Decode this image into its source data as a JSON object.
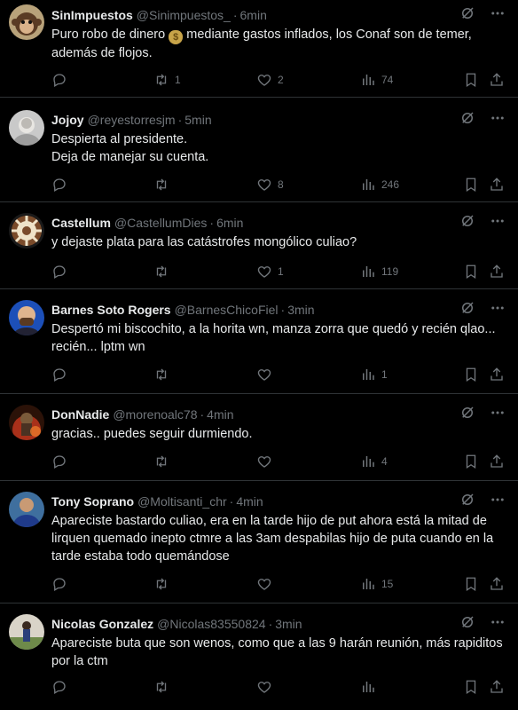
{
  "tweets": [
    {
      "name": "SinImpuestos",
      "handle": "@Sinimpuestos_",
      "time": "6min",
      "lines": [
        "Puro robo de dinero",
        "mediante gastos inflados, los Conaf son de temer,",
        "además de flojos."
      ],
      "emoji": "money-bag-emoji",
      "replies": "",
      "retweets": "1",
      "likes": "2",
      "views": "74",
      "avatar": "monkey-avatar"
    },
    {
      "name": "Jojoy",
      "handle": "@reyestorresjm",
      "time": "5min",
      "lines": [
        "Despierta al presidente.",
        "Deja de manejar su cuenta."
      ],
      "replies": "",
      "retweets": "",
      "likes": "8",
      "views": "246",
      "avatar": "person-avatar"
    },
    {
      "name": "Castellum",
      "handle": "@CastellumDies",
      "time": "6min",
      "lines": [
        "y dejaste plata para las catástrofes mongólico culiao?"
      ],
      "replies": "",
      "retweets": "",
      "likes": "1",
      "views": "119",
      "avatar": "wheel-avatar"
    },
    {
      "name": "Barnes Soto Rogers",
      "handle": "@BarnesChicoFiel",
      "time": "3min",
      "lines": [
        "Despertó mi biscochito, a la horita wn, manza zorra que quedó y recién qlao...",
        "recién... lptm wn"
      ],
      "replies": "",
      "retweets": "",
      "likes": "",
      "views": "1",
      "avatar": "bald-man-avatar"
    },
    {
      "name": "DonNadie",
      "handle": "@morenoalc78",
      "time": "4min",
      "lines": [
        "gracias.. puedes seguir durmiendo."
      ],
      "replies": "",
      "retweets": "",
      "likes": "",
      "views": "4",
      "avatar": "knight-avatar"
    },
    {
      "name": "Tony Soprano",
      "handle": "@Moltisanti_chr",
      "time": "4min",
      "lines": [
        "Apareciste bastardo culiao, era en la tarde hijo de put ahora está la mitad de",
        "lirquen quemado inepto ctmre a las 3am despabilas hijo de puta cuando en la",
        "tarde estaba todo quemándose"
      ],
      "replies": "",
      "retweets": "",
      "likes": "",
      "views": "15",
      "avatar": "blue-shirt-avatar"
    },
    {
      "name": "Nicolas Gonzalez",
      "handle": "@Nicolas83550824",
      "time": "3min",
      "lines": [
        "Apareciste buta que son wenos, como que a las 9 harán reunión, más rapiditos",
        "por la ctm"
      ],
      "replies": "",
      "retweets": "",
      "likes": "",
      "views": "",
      "avatar": "outdoor-person-avatar"
    }
  ],
  "dot": "·"
}
